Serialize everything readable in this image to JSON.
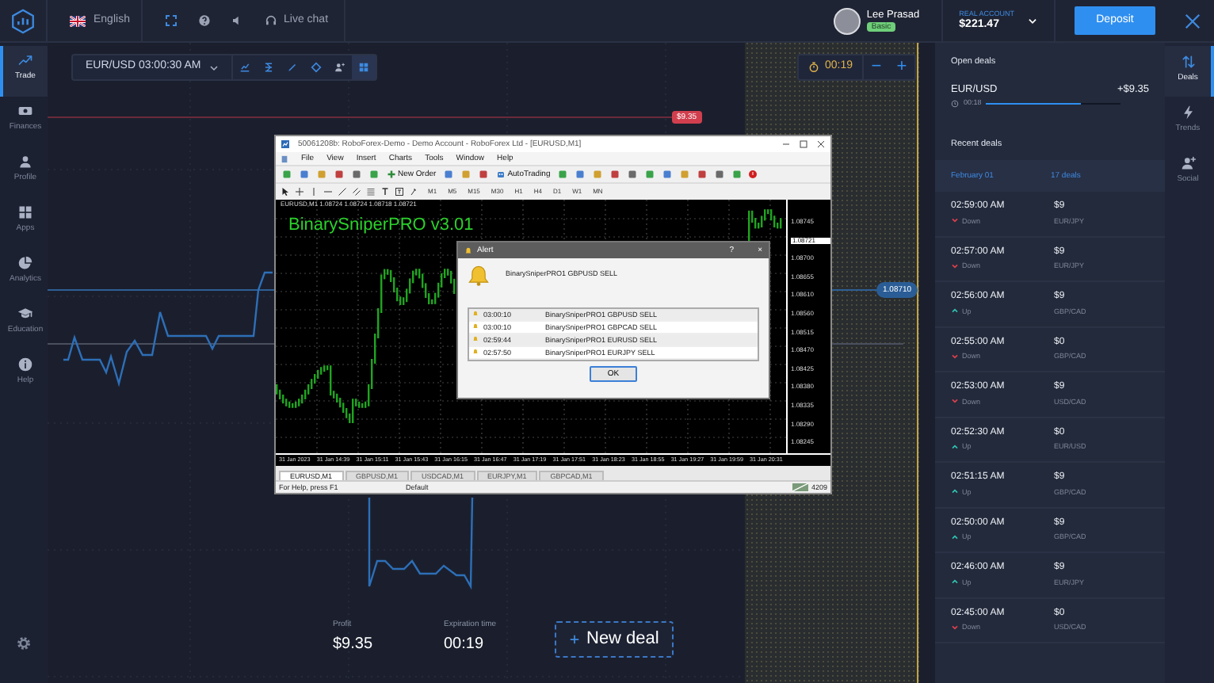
{
  "topbar": {
    "language": "English",
    "live_chat": "Live chat",
    "user": {
      "name": "Lee Prasad",
      "badge": "Basic"
    },
    "account": {
      "label": "REAL ACCOUNT",
      "balance": "$221.47"
    },
    "deposit": "Deposit"
  },
  "sidebar": {
    "items": [
      {
        "label": "Trade",
        "kind": "trade",
        "selected": true
      },
      {
        "label": "Finances",
        "kind": "finances",
        "selected": false
      },
      {
        "label": "Profile",
        "kind": "profile",
        "selected": false
      },
      {
        "label": "Apps",
        "kind": "apps",
        "selected": false
      },
      {
        "label": "Analytics",
        "kind": "analytics",
        "selected": false
      },
      {
        "label": "Education",
        "kind": "education",
        "selected": false
      },
      {
        "label": "Help",
        "kind": "help",
        "selected": false
      }
    ]
  },
  "chart_toolbar": {
    "asset": "EUR/USD 03:00:30 AM",
    "timer": "00:19",
    "minus": "−",
    "plus": "+"
  },
  "chart": {
    "deal_marker": "$9.35",
    "price_tag": "1.08710"
  },
  "mt4": {
    "title": "50061208b: RoboForex-Demo - Demo Account - RoboForex Ltd - [EURUSD,M1]",
    "menu": [
      "File",
      "View",
      "Insert",
      "Charts",
      "Tools",
      "Window",
      "Help"
    ],
    "toolbar": {
      "new_order": "New Order",
      "autotrading": "AutoTrading"
    },
    "timeframes": [
      "M1",
      "M5",
      "M15",
      "M30",
      "H1",
      "H4",
      "D1",
      "W1",
      "MN"
    ],
    "chart_info": "EURUSD,M1  1.08724 1.08724 1.08718 1.08721",
    "indicator_title": "BinarySniperPRO v3.01",
    "prices": [
      {
        "value": "1.08745",
        "current": false
      },
      {
        "value": "1.08721",
        "current": true
      },
      {
        "value": "1.08700",
        "current": false
      },
      {
        "value": "1.08655",
        "current": false
      },
      {
        "value": "1.08610",
        "current": false
      },
      {
        "value": "1.08560",
        "current": false
      },
      {
        "value": "1.08515",
        "current": false
      },
      {
        "value": "1.08470",
        "current": false
      },
      {
        "value": "1.08425",
        "current": false
      },
      {
        "value": "1.08380",
        "current": false
      },
      {
        "value": "1.08335",
        "current": false
      },
      {
        "value": "1.08290",
        "current": false
      },
      {
        "value": "1.08245",
        "current": false
      }
    ],
    "times": [
      "31 Jan 2023",
      "31 Jan 14:39",
      "31 Jan 15:11",
      "31 Jan 15:43",
      "31 Jan 16:15",
      "31 Jan 16:47",
      "31 Jan 17:19",
      "31 Jan 17:51",
      "31 Jan 18:23",
      "31 Jan 18:55",
      "31 Jan 19:27",
      "31 Jan 19:59",
      "31 Jan 20:31"
    ],
    "tabs": [
      {
        "label": "EURUSD,M1",
        "selected": true
      },
      {
        "label": "GBPUSD,M1",
        "selected": false
      },
      {
        "label": "USDCAD,M1",
        "selected": false
      },
      {
        "label": "EURJPY,M1",
        "selected": false
      },
      {
        "label": "GBPCAD,M1",
        "selected": false
      }
    ],
    "status": {
      "help": "For Help, press F1",
      "profile": "Default",
      "traffic": "4209"
    },
    "alert": {
      "title": "Alert",
      "help": "?",
      "close": "×",
      "message": "BinarySniperPRO1 GBPUSD SELL",
      "rows": [
        {
          "time": "03:00:10",
          "text": "BinarySniperPRO1 GBPUSD SELL"
        },
        {
          "time": "03:00:10",
          "text": "BinarySniperPRO1 GBPCAD SELL"
        },
        {
          "time": "02:59:44",
          "text": "BinarySniperPRO1 EURUSD SELL"
        },
        {
          "time": "02:57:50",
          "text": "BinarySniperPRO1 EURJPY SELL"
        }
      ],
      "ok": "OK"
    }
  },
  "bottom": {
    "profit_label": "Profit",
    "profit": "$9.35",
    "expiration_label": "Expiration time",
    "expiration": "00:19",
    "new_deal": "New deal"
  },
  "deals_panel": {
    "open_title": "Open deals",
    "open": [
      {
        "pair": "EUR/USD",
        "profit": "+$9.35",
        "timer": "00:18",
        "level": 0.7
      }
    ],
    "recent_title": "Recent deals",
    "date": "February 01",
    "count": "17 deals",
    "recent": [
      {
        "time": "02:59:00 AM",
        "kind": "down",
        "direction": "Down",
        "amount": "$9",
        "pair": "EUR/JPY"
      },
      {
        "time": "02:57:00 AM",
        "kind": "down",
        "direction": "Down",
        "amount": "$9",
        "pair": "EUR/JPY"
      },
      {
        "time": "02:56:00 AM",
        "kind": "up",
        "direction": "Up",
        "amount": "$9",
        "pair": "GBP/CAD"
      },
      {
        "time": "02:55:00 AM",
        "kind": "down",
        "direction": "Down",
        "amount": "$0",
        "pair": "GBP/CAD"
      },
      {
        "time": "02:53:00 AM",
        "kind": "down",
        "direction": "Down",
        "amount": "$9",
        "pair": "USD/CAD"
      },
      {
        "time": "02:52:30 AM",
        "kind": "up",
        "direction": "Up",
        "amount": "$0",
        "pair": "EUR/USD"
      },
      {
        "time": "02:51:15 AM",
        "kind": "up",
        "direction": "Up",
        "amount": "$9",
        "pair": "GBP/CAD"
      },
      {
        "time": "02:50:00 AM",
        "kind": "up",
        "direction": "Up",
        "amount": "$9",
        "pair": "GBP/CAD"
      },
      {
        "time": "02:46:00 AM",
        "kind": "up",
        "direction": "Up",
        "amount": "$9",
        "pair": "EUR/JPY"
      },
      {
        "time": "02:45:00 AM",
        "kind": "down",
        "direction": "Down",
        "amount": "$0",
        "pair": "USD/CAD"
      }
    ]
  },
  "right_strip": [
    {
      "label": "Deals",
      "kind": "deals",
      "selected": true
    },
    {
      "label": "Trends",
      "kind": "trends",
      "selected": false
    },
    {
      "label": "Social",
      "kind": "social",
      "selected": false
    }
  ]
}
